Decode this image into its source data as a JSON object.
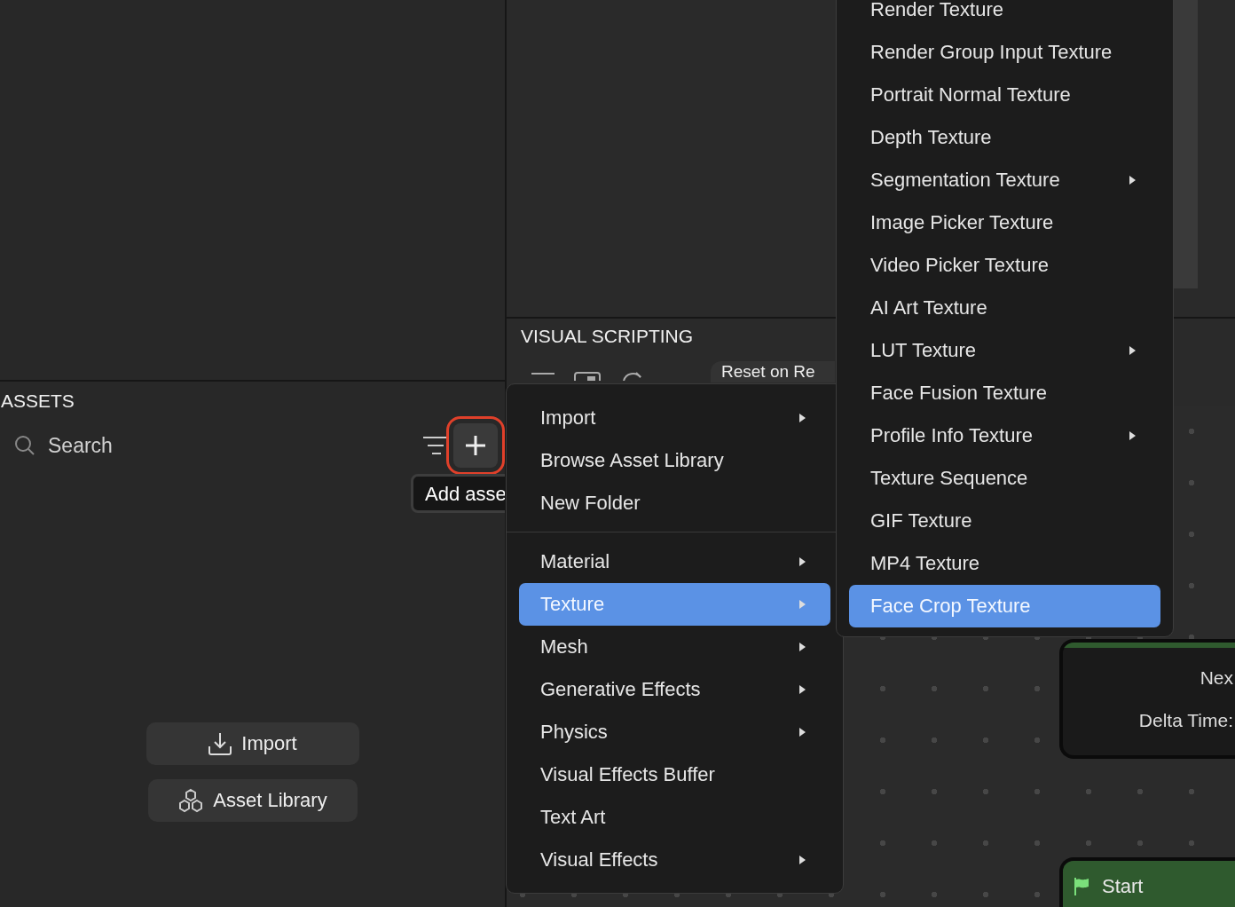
{
  "assets_panel": {
    "title": "ASSETS",
    "search": {
      "placeholder": "Search"
    },
    "add_button": {
      "highlighted": true
    },
    "tooltip": "Add asse",
    "buttons": [
      {
        "label": "Import"
      },
      {
        "label": "Asset Library"
      }
    ]
  },
  "visual_scripting": {
    "title": "VISUAL SCRIPTING",
    "toolbar_chip": "Reset on Re",
    "nodes": [
      {
        "kind": "event",
        "lines": [
          "Nex",
          "Delta Time:"
        ]
      },
      {
        "kind": "start",
        "title": "Start"
      }
    ]
  },
  "context_menu": {
    "groups": [
      [
        {
          "label": "Import",
          "has_submenu": true,
          "selected": false
        },
        {
          "label": "Browse Asset Library",
          "has_submenu": false,
          "selected": false
        },
        {
          "label": "New Folder",
          "has_submenu": false,
          "selected": false
        }
      ],
      [
        {
          "label": "Material",
          "has_submenu": true,
          "selected": false
        },
        {
          "label": "Texture",
          "has_submenu": true,
          "selected": true
        },
        {
          "label": "Mesh",
          "has_submenu": true,
          "selected": false
        },
        {
          "label": "Generative Effects",
          "has_submenu": true,
          "selected": false
        },
        {
          "label": "Physics",
          "has_submenu": true,
          "selected": false
        },
        {
          "label": "Visual Effects Buffer",
          "has_submenu": false,
          "selected": false
        },
        {
          "label": "Text Art",
          "has_submenu": false,
          "selected": false
        },
        {
          "label": "Visual Effects",
          "has_submenu": true,
          "selected": false
        }
      ]
    ]
  },
  "submenu": {
    "groups": [
      [
        {
          "label": "Render Texture",
          "has_submenu": false,
          "selected": false
        },
        {
          "label": "Render Group Input Texture",
          "has_submenu": false,
          "selected": false
        },
        {
          "label": "Portrait Normal Texture",
          "has_submenu": false,
          "selected": false
        },
        {
          "label": "Depth Texture",
          "has_submenu": false,
          "selected": false
        },
        {
          "label": "Segmentation Texture",
          "has_submenu": true,
          "selected": false
        },
        {
          "label": "Image Picker Texture",
          "has_submenu": false,
          "selected": false
        },
        {
          "label": "Video Picker Texture",
          "has_submenu": false,
          "selected": false
        },
        {
          "label": "AI Art Texture",
          "has_submenu": false,
          "selected": false
        },
        {
          "label": "LUT Texture",
          "has_submenu": true,
          "selected": false
        },
        {
          "label": "Face Fusion Texture",
          "has_submenu": false,
          "selected": false
        },
        {
          "label": "Profile Info Texture",
          "has_submenu": true,
          "selected": false
        },
        {
          "label": "Texture Sequence",
          "has_submenu": false,
          "selected": false
        },
        {
          "label": "GIF Texture",
          "has_submenu": false,
          "selected": false
        },
        {
          "label": "MP4 Texture",
          "has_submenu": false,
          "selected": false
        },
        {
          "label": "Face Crop Texture",
          "has_submenu": false,
          "selected": true
        }
      ]
    ]
  }
}
